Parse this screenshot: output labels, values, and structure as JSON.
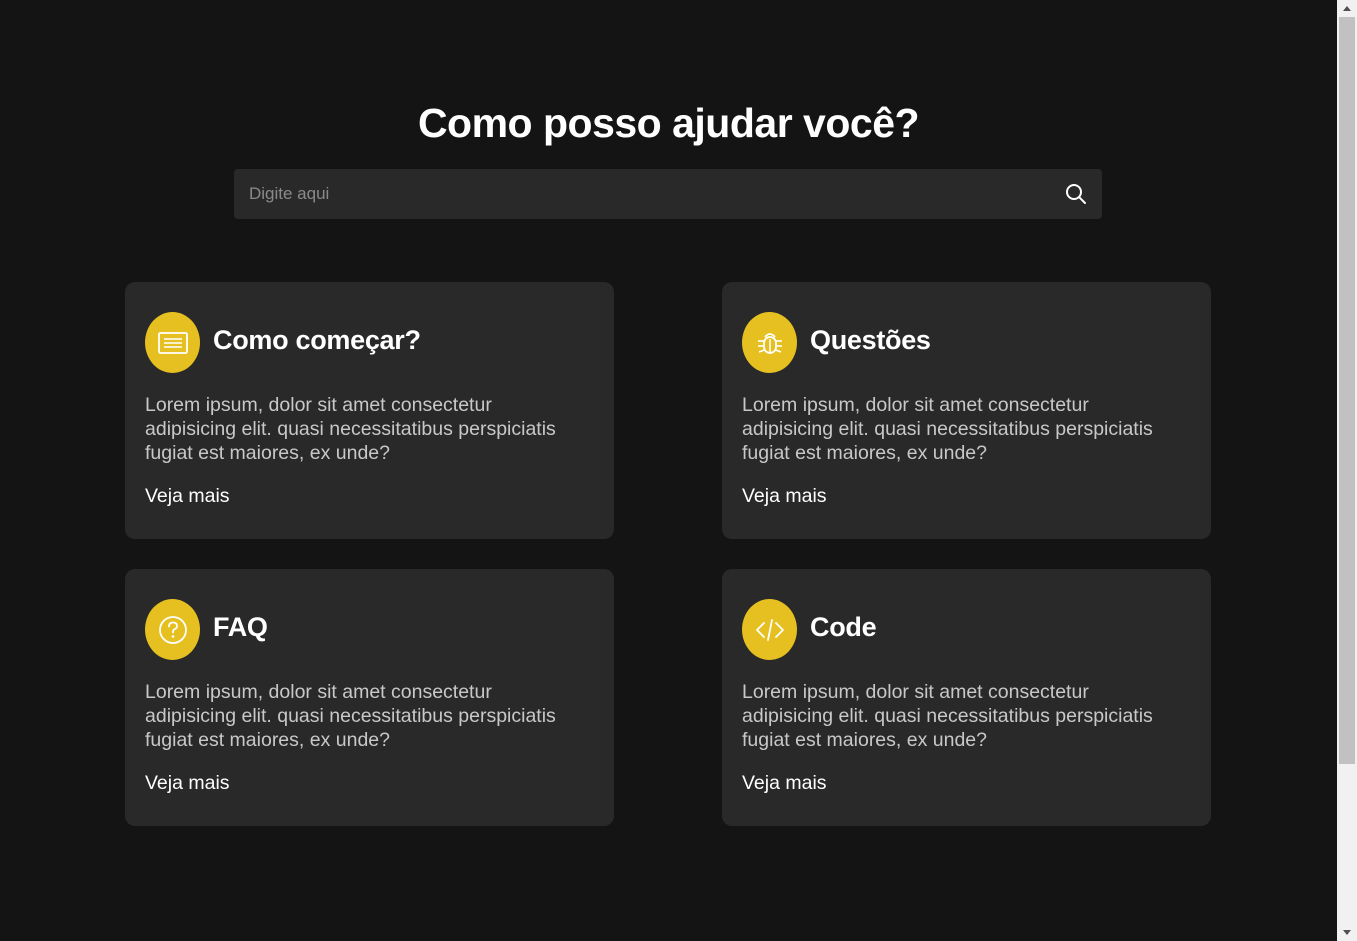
{
  "hero": {
    "title": "Como posso ajudar você?"
  },
  "search": {
    "placeholder": "Digite aqui",
    "value": "",
    "icon": "search-icon"
  },
  "cards": [
    {
      "icon": "document-icon",
      "title": "Como começar?",
      "text": "Lorem ipsum, dolor sit amet consectetur adipisicing elit. quasi necessitatibus perspiciatis fugiat est maiores, ex unde?",
      "link": "Veja mais"
    },
    {
      "icon": "bug-icon",
      "title": "Questões",
      "text": "Lorem ipsum, dolor sit amet consectetur adipisicing elit. quasi necessitatibus perspiciatis fugiat est maiores, ex unde?",
      "link": "Veja mais"
    },
    {
      "icon": "question-circle-icon",
      "title": "FAQ",
      "text": "Lorem ipsum, dolor sit amet consectetur adipisicing elit. quasi necessitatibus perspiciatis fugiat est maiores, ex unde?",
      "link": "Veja mais"
    },
    {
      "icon": "code-icon",
      "title": "Code",
      "text": "Lorem ipsum, dolor sit amet consectetur adipisicing elit. quasi necessitatibus perspiciatis fugiat est maiores, ex unde?",
      "link": "Veja mais"
    }
  ],
  "colors": {
    "background": "#141414",
    "card": "#292929",
    "accent": "#e5c020",
    "text": "#ffffff",
    "muted_text": "#c8c8c8"
  }
}
